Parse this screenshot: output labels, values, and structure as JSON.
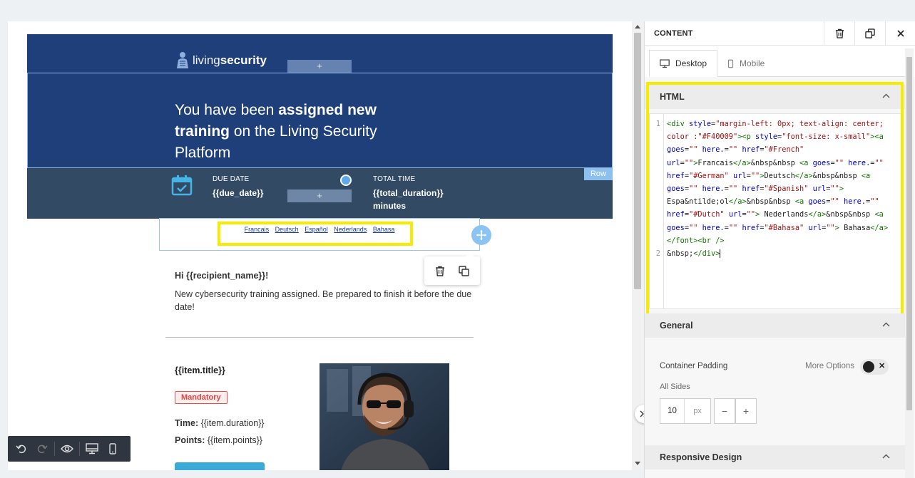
{
  "email": {
    "logo_light": "living",
    "logo_bold": "security",
    "headline": {
      "part1": "You have been ",
      "bold1": "assigned new training",
      "part2": " on the Living Security Platform"
    },
    "due_label": "DUE DATE",
    "due_value": "{{due_date}}",
    "total_label": "TOTAL TIME",
    "total_value": "{{total_duration}}",
    "total_unit": "minutes",
    "row_tag": "Row",
    "add_symbol": "+",
    "languages": [
      "Francais",
      "Deutsch",
      "Español",
      "Nederlands",
      "Bahasa"
    ],
    "greeting": "Hi {{recipient_name}}!",
    "body": "New cybersecurity training assigned. Be prepared to finish it before the due date!",
    "item_title": "{{item.title}}",
    "mandatory": "Mandatory",
    "time_label": "Time:",
    "time_value": " {{item.duration}}",
    "points_label": "Points:",
    "points_value": " {{item.points}}"
  },
  "panel": {
    "title": "CONTENT",
    "tabs": [
      {
        "label": "Desktop",
        "active": true
      },
      {
        "label": "Mobile",
        "active": false
      }
    ],
    "sections": {
      "html": "HTML",
      "general": "General",
      "responsive": "Responsive Design"
    },
    "container_padding": "Container Padding",
    "more_options": "More Options",
    "all_sides": "All Sides",
    "padding_value": "10",
    "padding_unit": "px",
    "minus": "−",
    "plus": "+",
    "code_line_numbers": [
      "1",
      "2"
    ]
  },
  "colors": {
    "header_blue": "#1f3f7a",
    "info_bar": "#324a64",
    "highlight": "#f5ec00",
    "accent": "#3aaad8",
    "mandatory": "#e04343"
  }
}
